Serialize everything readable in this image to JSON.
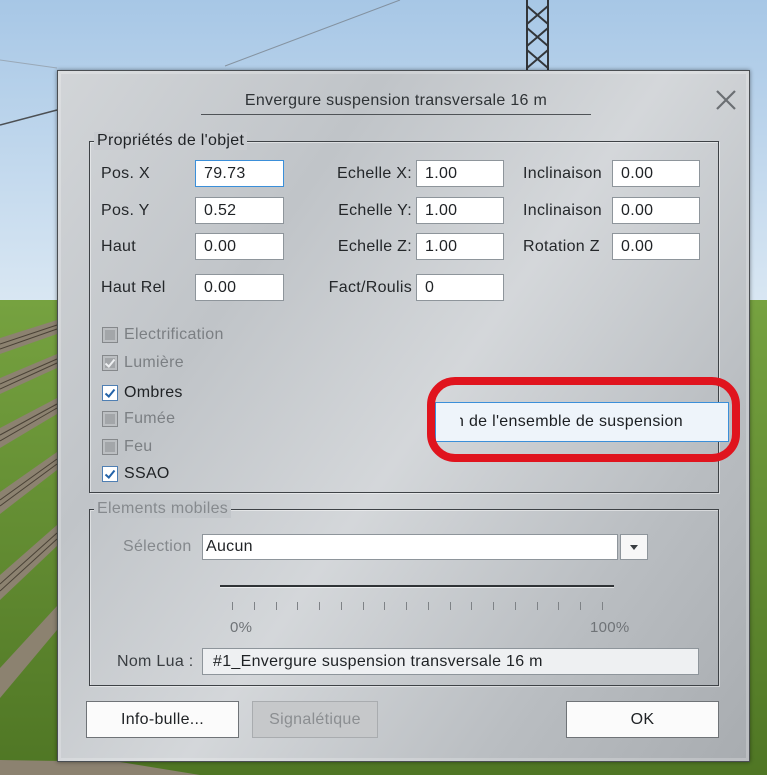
{
  "window": {
    "title": "Envergure suspension transversale 16 m"
  },
  "icons": {
    "close": "close-icon",
    "dropdown": "chevron-down-icon",
    "check": "checkmark-icon"
  },
  "properties": {
    "legend": "Propriétés de l'objet",
    "pos_x": {
      "label": "Pos. X",
      "value": "79.73"
    },
    "pos_y": {
      "label": "Pos. Y",
      "value": "0.52"
    },
    "haut": {
      "label": "Haut",
      "value": "0.00"
    },
    "haut_rel": {
      "label": "Haut Rel",
      "value": "0.00"
    },
    "echelle_x": {
      "label": "Echelle X:",
      "value": "1.00"
    },
    "echelle_y": {
      "label": "Echelle Y:",
      "value": "1.00"
    },
    "echelle_z": {
      "label": "Echelle Z:",
      "value": "1.00"
    },
    "fact_roulis": {
      "label": "Fact/Roulis",
      "value": "0"
    },
    "inclinaison_1": {
      "label": "Inclinaison",
      "value": "0.00"
    },
    "inclinaison_2": {
      "label": "Inclinaison",
      "value": "0.00"
    },
    "rotation_z": {
      "label": "Rotation Z",
      "value": "0.00"
    },
    "options": [
      {
        "label": "Electrification",
        "checked": false,
        "enabled": false
      },
      {
        "label": "Lumière",
        "checked": true,
        "enabled": false
      },
      {
        "label": "Ombres",
        "checked": true,
        "enabled": true
      },
      {
        "label": "Fumée",
        "checked": false,
        "enabled": false
      },
      {
        "label": "Feu",
        "checked": false,
        "enabled": false
      },
      {
        "label": "SSAO",
        "checked": true,
        "enabled": true
      }
    ],
    "suspension_button": {
      "label": "n de l'ensemble de suspension"
    }
  },
  "mobile": {
    "legend": "Elements mobiles",
    "selection_label": "Sélection",
    "selection_value": "Aucun",
    "slider_min_label": "0%",
    "slider_max_label": "100%",
    "lua_label": "Nom Lua :",
    "lua_value": "#1_Envergure suspension transversale 16 m"
  },
  "buttons": {
    "tooltip": "Info-bulle...",
    "signage": "Signalétique",
    "signage_enabled": false,
    "ok": "OK"
  },
  "colors": {
    "annotation": "#e0141e",
    "accent": "#3b8fd9"
  }
}
